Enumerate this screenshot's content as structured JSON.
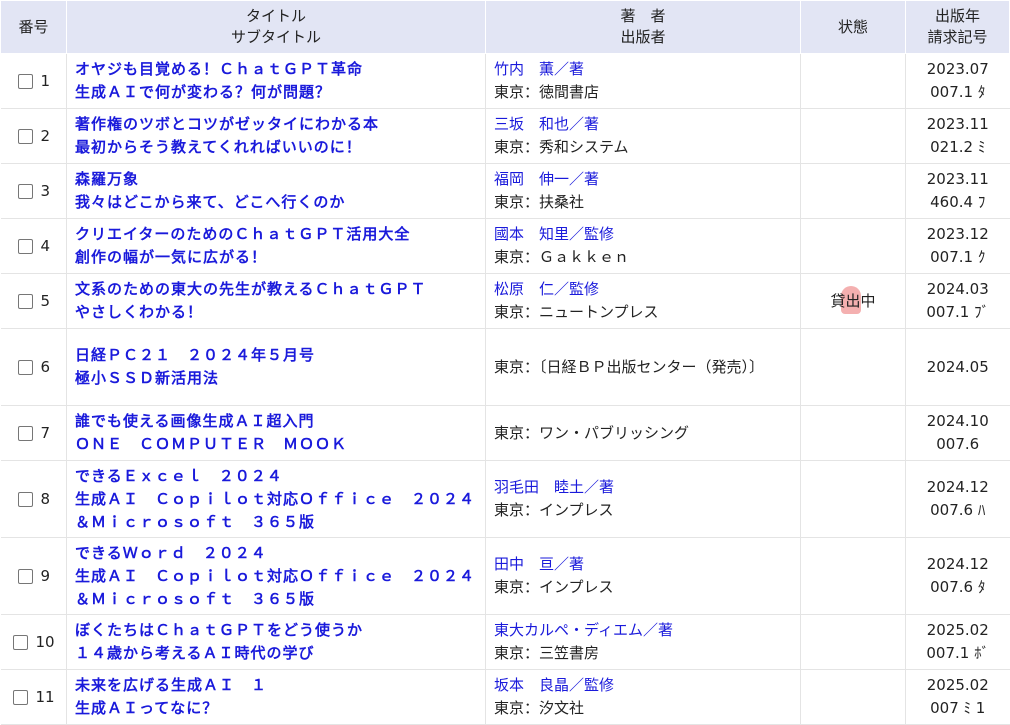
{
  "header": {
    "number": "番号",
    "title": "タイトル",
    "subtitle": "サブタイトル",
    "author": "著　者",
    "publisher": "出版者",
    "status": "状態",
    "pubyear": "出版年",
    "callno": "請求記号"
  },
  "rows": [
    {
      "no": "1",
      "title": "オヤジも目覚める！ＣｈａｔＧＰＴ革命",
      "subtitle": "生成ＡＩで何が変わる？何が問題？",
      "author": "竹内　薫／著",
      "publisher": "東京：徳間書店",
      "status": "",
      "date": "2023.07",
      "call": "007.1 ﾀ"
    },
    {
      "no": "2",
      "title": "著作権のツボとコツがゼッタイにわかる本",
      "subtitle": "最初からそう教えてくれればいいのに！",
      "author": "三坂　和也／著",
      "publisher": "東京：秀和システム",
      "status": "",
      "date": "2023.11",
      "call": "021.2 ﾐ"
    },
    {
      "no": "3",
      "title": "森羅万象",
      "subtitle": "我々はどこから来て、どこへ行くのか",
      "author": "福岡　伸一／著",
      "publisher": "東京：扶桑社",
      "status": "",
      "date": "2023.11",
      "call": "460.4 ﾌ"
    },
    {
      "no": "4",
      "title": "クリエイターのためのＣｈａｔＧＰＴ活用大全",
      "subtitle": "創作の幅が一気に広がる！",
      "author": "國本　知里／監修",
      "publisher": "東京：Ｇａｋｋｅｎ",
      "status": "",
      "date": "2023.12",
      "call": "007.1 ｸ"
    },
    {
      "no": "5",
      "title": "文系のための東大の先生が教えるＣｈａｔＧＰＴ",
      "subtitle": "やさしくわかる！",
      "author": "松原　仁／監修",
      "publisher": "東京：ニュートンプレス",
      "status": "貸出中",
      "date": "2024.03",
      "call": "007.1 ﾌﾞ"
    },
    {
      "no": "6",
      "title": "日経ＰＣ２１　２０２４年５月号",
      "subtitle": "極小ＳＳＤ新活用法",
      "author": "",
      "publisher": "東京：〔日経ＢＰ出版センター（発売）〕",
      "status": "",
      "date": "2024.05",
      "call": ""
    },
    {
      "no": "7",
      "title": "誰でも使える画像生成ＡＩ超入門",
      "subtitle": "ＯＮＥ　ＣＯＭＰＵＴＥＲ　ＭＯＯＫ",
      "author": "",
      "publisher": "東京：ワン・パブリッシング",
      "status": "",
      "date": "2024.10",
      "call": "007.6"
    },
    {
      "no": "8",
      "title": "できるＥｘｃｅｌ　２０２４",
      "subtitle": "生成ＡＩ　Ｃｏｐｉｌｏｔ対応Ｏｆｆｉｃｅ　２０２４＆Ｍｉｃｒｏｓｏｆｔ　３６５版",
      "author": "羽毛田　睦土／著",
      "publisher": "東京：インプレス",
      "status": "",
      "date": "2024.12",
      "call": "007.6 ﾊ"
    },
    {
      "no": "9",
      "title": "できるＷｏｒｄ　２０２４",
      "subtitle": "生成ＡＩ　Ｃｏｐｉｌｏｔ対応Ｏｆｆｉｃｅ　２０２４＆Ｍｉｃｒｏｓｏｆｔ　３６５版",
      "author": "田中　亘／著",
      "publisher": "東京：インプレス",
      "status": "",
      "date": "2024.12",
      "call": "007.6 ﾀ"
    },
    {
      "no": "10",
      "title": "ぼくたちはＣｈａｔＧＰＴをどう使うか",
      "subtitle": "１４歳から考えるＡＩ時代の学び",
      "author": "東大カルペ・ディエム／著",
      "publisher": "東京：三笠書房",
      "status": "",
      "date": "2025.02",
      "call": "007.1 ﾎﾞ"
    },
    {
      "no": "11",
      "title": "未来を広げる生成ＡＩ　１",
      "subtitle": "生成ＡＩってなに？",
      "author": "坂本　良晶／監修",
      "publisher": "東京：汐文社",
      "status": "",
      "date": "2025.02",
      "call": "007 ﾐ 1"
    }
  ]
}
